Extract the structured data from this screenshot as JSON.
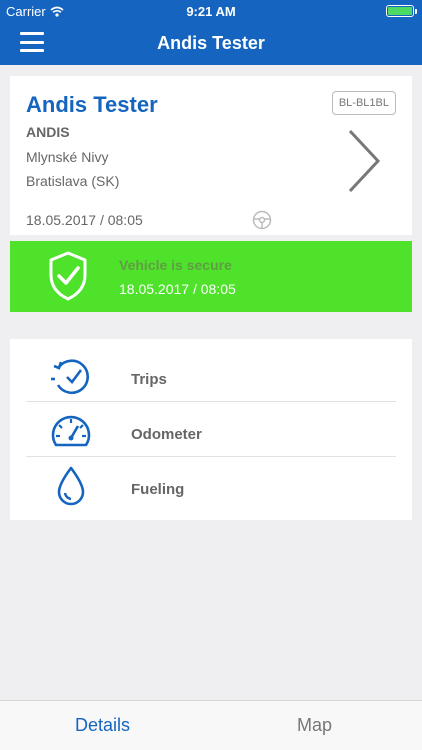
{
  "status_bar": {
    "carrier": "Carrier",
    "time": "9:21 AM"
  },
  "nav": {
    "title": "Andis Tester"
  },
  "vehicle": {
    "name": "Andis Tester",
    "company": "ANDIS",
    "street": "Mlynské Nivy",
    "city": "Bratislava (SK)",
    "date": "18.05.2017 / 08:05",
    "plate": "BL-BL1BL"
  },
  "security": {
    "status": "Vehicle is secure",
    "date": "18.05.2017 / 08:05"
  },
  "menu": {
    "items": [
      {
        "label": "Trips",
        "icon": "trips-icon"
      },
      {
        "label": "Odometer",
        "icon": "odometer-icon"
      },
      {
        "label": "Fueling",
        "icon": "fuel-drop-icon"
      }
    ]
  },
  "tabs": {
    "details": "Details",
    "map": "Map"
  },
  "colors": {
    "primary": "#1565c0",
    "secure_green": "#4fe22a",
    "background": "#efeff2"
  }
}
